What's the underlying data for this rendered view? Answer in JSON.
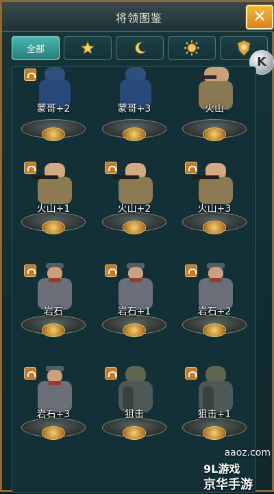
{
  "window": {
    "title": "将领图鉴",
    "close_label": "✕"
  },
  "tabs": [
    {
      "label": "全部",
      "icon": "text"
    },
    {
      "label": "",
      "icon": "star-icon"
    },
    {
      "label": "",
      "icon": "moon-icon"
    },
    {
      "label": "",
      "icon": "sun-icon"
    },
    {
      "label": "",
      "icon": "shield-icon"
    }
  ],
  "overlay": {
    "k_button_label": "K"
  },
  "generals": [
    {
      "name": "蒙哥+2"
    },
    {
      "name": "蒙哥+3"
    },
    {
      "name": "火山"
    },
    {
      "name": "火山+1"
    },
    {
      "name": "火山+2"
    },
    {
      "name": "火山+3"
    },
    {
      "name": "岩石"
    },
    {
      "name": "岩石+1"
    },
    {
      "name": "岩石+2"
    },
    {
      "name": "岩石+3"
    },
    {
      "name": "狙击"
    },
    {
      "name": "狙击+1"
    }
  ],
  "watermark": {
    "url": "aaoz.com",
    "brand_line1": "9L游戏",
    "brand_line2": "京华手游"
  },
  "colors": {
    "frame": "#8a6a3a",
    "accent_tab": "#2f9f98",
    "close": "#e6961f"
  }
}
